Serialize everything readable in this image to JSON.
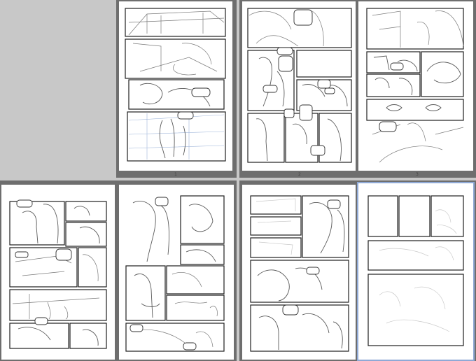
{
  "workspace": {
    "background": "#c8c8c8",
    "spread_color": "#6e6e6e",
    "selection_color": "#8fa9d6"
  },
  "pages": [
    {
      "number": "1",
      "state": "pencils"
    },
    {
      "number": "2",
      "state": "pencils"
    },
    {
      "number": "3",
      "state": "pencils"
    },
    {
      "number": "",
      "state": "pencils"
    },
    {
      "number": "",
      "state": "pencils"
    },
    {
      "number": "",
      "state": "pencils"
    },
    {
      "number": "",
      "state": "layout",
      "selected": true
    }
  ]
}
